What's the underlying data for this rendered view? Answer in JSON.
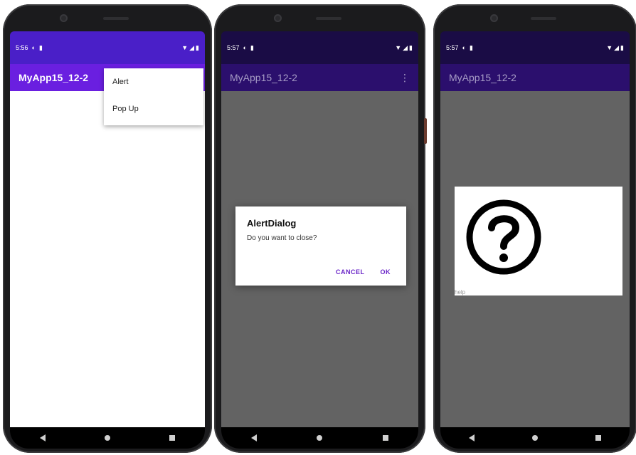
{
  "phones": [
    {
      "status": {
        "time": "5:56"
      },
      "app_bar": {
        "title": "MyApp15_12-2"
      },
      "menu": {
        "items": [
          "Alert",
          "Pop Up"
        ]
      }
    },
    {
      "status": {
        "time": "5:57"
      },
      "app_bar": {
        "title": "MyApp15_12-2",
        "overflow_icon": "more-vert-icon"
      },
      "dialog": {
        "title": "AlertDialog",
        "message": "Do you want to close?",
        "cancel_label": "CANCEL",
        "ok_label": "OK"
      }
    },
    {
      "status": {
        "time": "5:57"
      },
      "app_bar": {
        "title": "MyApp15_12-2"
      },
      "popup": {
        "icon": "help-circle-icon",
        "caption": "help"
      }
    }
  ],
  "colors": {
    "status_bar_active": "#4a1fc8",
    "app_bar_active": "#6a1fe0",
    "app_bar_dimmed": "#2b0f6d",
    "scrim": "#636363",
    "accent": "#6a25c8"
  }
}
